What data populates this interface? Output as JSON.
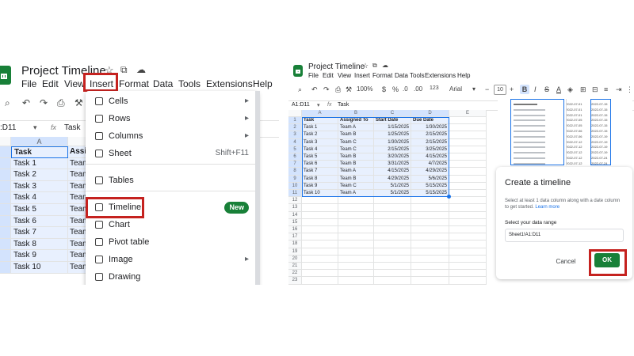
{
  "left": {
    "doc_title": "Project Timeline",
    "menu": [
      "File",
      "Edit",
      "View",
      "Insert",
      "Format",
      "Data",
      "Tools",
      "Extensions",
      "Help"
    ],
    "name_box": ":D11",
    "formula": "Task",
    "col_a": "A",
    "row_numbers": [
      "",
      "",
      "",
      "",
      "",
      "",
      "",
      "",
      "",
      ""
    ],
    "tasks": [
      "Task",
      "Task 1",
      "Task 2",
      "Task 3",
      "Task 4",
      "Task 5",
      "Task 6",
      "Task 7",
      "Task 8",
      "Task 9",
      "Task 10"
    ],
    "col_b_partial": [
      "Assi",
      "Team",
      "Team",
      "Team",
      "Team",
      "Team",
      "Team",
      "Team",
      "Team",
      "Team",
      "Team"
    ],
    "insert_menu": {
      "items": [
        {
          "label": "Cells",
          "right": "▸",
          "icon": "cells-icon"
        },
        {
          "label": "Rows",
          "right": "▸",
          "icon": "rows-icon"
        },
        {
          "label": "Columns",
          "right": "▸",
          "icon": "columns-icon"
        },
        {
          "label": "Sheet",
          "right": "Shift+F11",
          "icon": "sheet-icon"
        },
        {
          "label": "Tables",
          "right": "",
          "icon": "tables-icon"
        },
        {
          "label": "Timeline",
          "right": "",
          "icon": "timeline-icon",
          "badge": "New"
        },
        {
          "label": "Chart",
          "right": "",
          "icon": "chart-icon"
        },
        {
          "label": "Pivot table",
          "right": "",
          "icon": "pivot-table-icon"
        },
        {
          "label": "Image",
          "right": "▸",
          "icon": "image-icon"
        },
        {
          "label": "Drawing",
          "right": "",
          "icon": "drawing-icon"
        }
      ]
    }
  },
  "right": {
    "doc_title": "Project Timeline",
    "menu": [
      "File",
      "Edit",
      "View",
      "Insert",
      "Format",
      "Data",
      "Tools",
      "Extensions",
      "Help"
    ],
    "zoom": "100%",
    "font": "Arial",
    "font_size": "10",
    "name_box": "A1:D11",
    "formula": "Task",
    "columns": [
      "A",
      "B",
      "C",
      "D",
      "E"
    ],
    "table": [
      [
        "Task",
        "Assigned To",
        "Start Date",
        "Due Date"
      ],
      [
        "Task 1",
        "Team A",
        "1/15/2025",
        "1/30/2025"
      ],
      [
        "Task 2",
        "Team B",
        "1/25/2025",
        "2/15/2025"
      ],
      [
        "Task 3",
        "Team C",
        "1/30/2025",
        "2/15/2025"
      ],
      [
        "Task 4",
        "Team C",
        "2/15/2025",
        "3/25/2025"
      ],
      [
        "Task 5",
        "Team B",
        "3/20/2025",
        "4/15/2025"
      ],
      [
        "Task 6",
        "Team B",
        "3/31/2025",
        "4/7/2025"
      ],
      [
        "Task 7",
        "Team A",
        "4/15/2025",
        "4/29/2025"
      ],
      [
        "Task 8",
        "Team B",
        "4/29/2025",
        "5/6/2025"
      ],
      [
        "Task 9",
        "Team C",
        "5/1/2025",
        "5/15/2025"
      ],
      [
        "Task 10",
        "Team A",
        "5/1/2025",
        "5/15/2025"
      ]
    ],
    "row_nums": [
      "1",
      "2",
      "3",
      "4",
      "5",
      "6",
      "7",
      "8",
      "9",
      "10",
      "11",
      "12",
      "13",
      "14",
      "15",
      "16",
      "17",
      "18",
      "19",
      "20",
      "21",
      "22",
      "23"
    ],
    "preview_dates_a": [
      "2022-07-01",
      "2022-07-01",
      "2022-07-01",
      "2022-07-05",
      "2022-07-05",
      "2022-07-06",
      "2022-07-06",
      "2022-07-12",
      "2022-07-12",
      "2022-07-12",
      "2022-07-12",
      "2022-07-12"
    ],
    "preview_dates_b": [
      "2022-07-15",
      "2022-07-15",
      "2022-07-15",
      "2022-07-15",
      "2022-07-15",
      "2022-07-15",
      "2022-07-19",
      "2022-07-19",
      "2022-07-19",
      "2022-07-19",
      "2022-07-24",
      "2022-07-24"
    ],
    "dialog": {
      "title": "Create a timeline",
      "desc": "Select at least 1 data column along with a date column to get started.",
      "learn_more": "Learn more",
      "range_label": "Select your data range",
      "range_value": "Sheet1!A1:D11",
      "cancel": "Cancel",
      "ok": "OK"
    }
  },
  "colors": {
    "accent": "#1a73e8",
    "green": "#188038",
    "red": "#c5221f",
    "selection": "#e8f0fe"
  }
}
